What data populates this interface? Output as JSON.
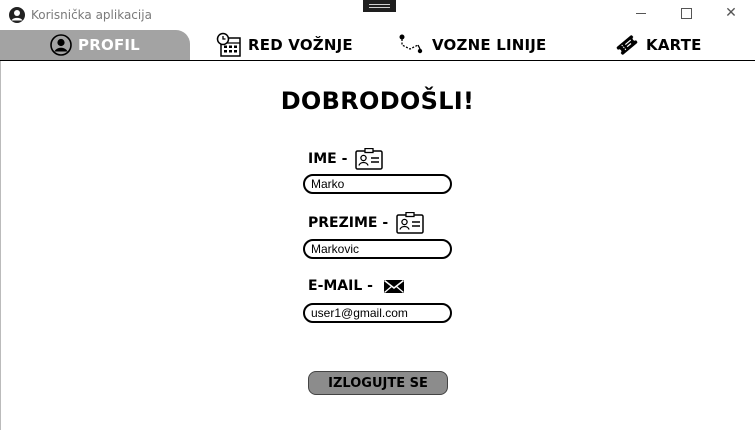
{
  "window": {
    "title": "Korisnička aplikacija",
    "close_glyph": "✕"
  },
  "tabs": [
    {
      "label": "PROFIL",
      "icon": "user-circle-icon",
      "active": true
    },
    {
      "label": "RED VOŽNJE",
      "icon": "calendar-clock-icon",
      "active": false
    },
    {
      "label": "VOZNE LINIJE",
      "icon": "route-icon",
      "active": false
    },
    {
      "label": "KARTE",
      "icon": "ticket-icon",
      "active": false
    }
  ],
  "profile": {
    "heading": "DOBRODOŠLI!",
    "fields": [
      {
        "label": "IME  -",
        "value": "Marko",
        "icon": "id-card-icon"
      },
      {
        "label": "PREZIME  -",
        "value": "Markovic",
        "icon": "id-card-icon"
      },
      {
        "label": "E-MAIL  -",
        "value": "user1@gmail.com",
        "icon": "envelope-icon"
      }
    ],
    "logout_label": "IZLOGUJTE SE"
  },
  "colors": {
    "active_tab": "#a3a3a3",
    "logout_button": "#8c8c8c",
    "title_text": "#7a7a7a"
  }
}
